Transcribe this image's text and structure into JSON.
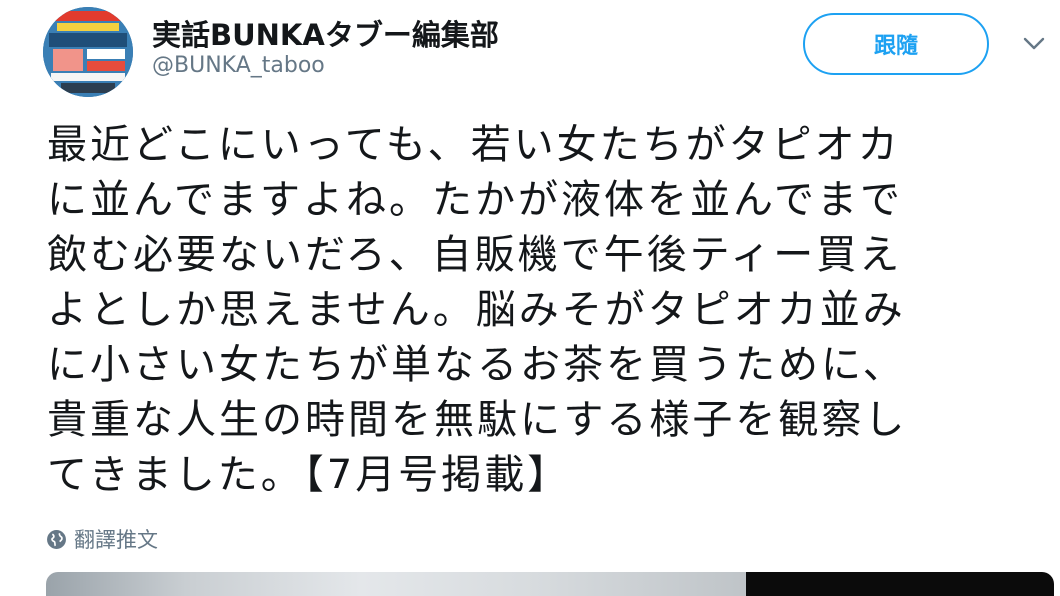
{
  "user": {
    "display_name": "実話BUNKAタブー編集部",
    "handle": "@BUNKA_taboo",
    "avatar_icon": "magazine-cover-avatar"
  },
  "follow_button": {
    "label": "跟隨"
  },
  "menu_icon": "chevron-down-icon",
  "tweet": {
    "lines": [
      "最近どこにいっても、若い女たちがタピオカ",
      "に並んでますよね。たかが液体を並んでまで",
      "飲む必要ないだろ、自販機で午後ティー買え",
      "よとしか思えません。脳みそがタピオカ並み",
      "に小さい女たちが単なるお茶を買うために、",
      "貴重な人生の時間を無駄にする様子を観察し",
      "てきました。【7月号掲載】"
    ]
  },
  "translate": {
    "label": "翻譯推文",
    "icon": "globe-icon"
  },
  "colors": {
    "accent": "#1da1f2",
    "text": "#14171a",
    "secondary": "#657786"
  }
}
